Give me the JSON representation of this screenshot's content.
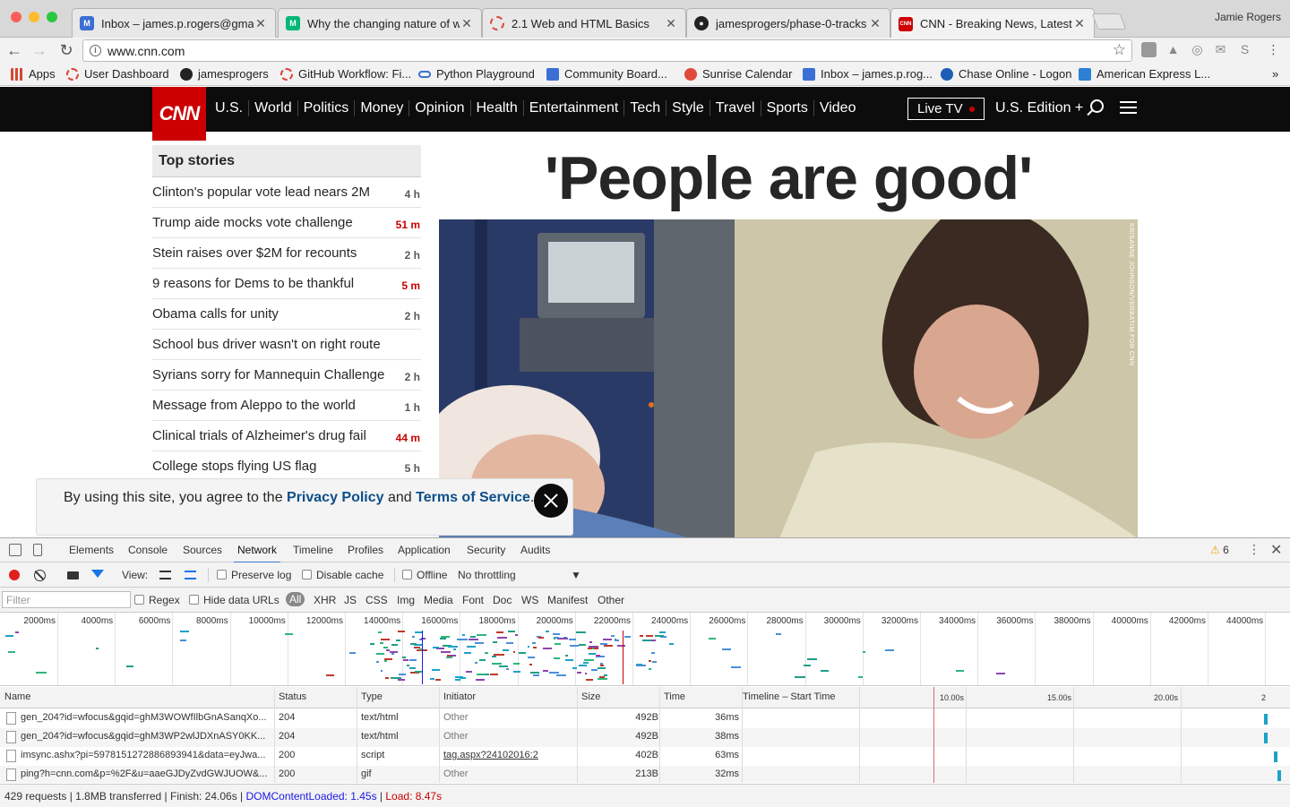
{
  "browser": {
    "tabs": [
      {
        "title": "Inbox – james.p.rogers@gmail.com",
        "icon": "gmail-icon",
        "color": "#3b6fd4"
      },
      {
        "title": "Why the changing nature of work",
        "icon": "medium-icon",
        "color": "#02b875"
      },
      {
        "title": "2.1 Web and HTML Basics",
        "icon": "loading-icon",
        "color": "#d9463a"
      },
      {
        "title": "jamesprogers/phase-0-tracks",
        "icon": "github-icon",
        "color": "#222222"
      },
      {
        "title": "CNN - Breaking News, Latest N",
        "icon": "cnn-icon",
        "color": "#cc0000"
      }
    ],
    "profile_name": "Jamie Rogers",
    "url": "www.cnn.com",
    "bookmarks": [
      {
        "label": "Apps",
        "icon": "apps-icon",
        "color": "#d04a32"
      },
      {
        "label": "User Dashboard",
        "icon": "loading-icon",
        "color": "#d9463a"
      },
      {
        "label": "jamesprogers",
        "icon": "github-icon",
        "color": "#222222"
      },
      {
        "label": "GitHub Workflow: Fi...",
        "icon": "loading-icon",
        "color": "#d9463a"
      },
      {
        "label": "Python Playground",
        "icon": "link-icon",
        "color": "#3b6fd4"
      },
      {
        "label": "Community Board...",
        "icon": "community-icon",
        "color": "#3b6fd4"
      },
      {
        "label": "Sunrise Calendar",
        "icon": "calendar-icon",
        "color": "#e04a3b"
      },
      {
        "label": "Inbox – james.p.rog...",
        "icon": "inbox-icon",
        "color": "#3b6fd4"
      },
      {
        "label": "Chase Online - Logon",
        "icon": "chase-icon",
        "color": "#1a5fb4"
      },
      {
        "label": "American Express L...",
        "icon": "amex-icon",
        "color": "#2e7fd6"
      }
    ],
    "bookmarks_overflow": "»"
  },
  "cnn": {
    "logo": "CNN",
    "nav_links": [
      "U.S.",
      "World",
      "Politics",
      "Money",
      "Opinion",
      "Health",
      "Entertainment",
      "Tech",
      "Style",
      "Travel",
      "Sports",
      "Video"
    ],
    "live_tv": "Live TV",
    "edition": "U.S. Edition +",
    "top_stories_title": "Top stories",
    "stories": [
      {
        "headline": "Clinton's popular vote lead nears 2M",
        "age": "4 h",
        "recent": false
      },
      {
        "headline": "Trump aide mocks vote challenge",
        "age": "51 m",
        "recent": true
      },
      {
        "headline": "Stein raises over $2M for recounts",
        "age": "2 h",
        "recent": false
      },
      {
        "headline": "9 reasons for Dems to be thankful",
        "age": "5 m",
        "recent": true
      },
      {
        "headline": "Obama calls for unity",
        "age": "2 h",
        "recent": false
      },
      {
        "headline": "School bus driver wasn't on right route",
        "age": "",
        "recent": false
      },
      {
        "headline": "Syrians sorry for Mannequin Challenge",
        "age": "2 h",
        "recent": false
      },
      {
        "headline": "Message from Aleppo to the world",
        "age": "1 h",
        "recent": false
      },
      {
        "headline": "Clinical trials of Alzheimer's drug fail",
        "age": "44 m",
        "recent": true
      },
      {
        "headline": "College stops flying US flag",
        "age": "5 h",
        "recent": false
      }
    ],
    "main_headline": "'People are good'",
    "photo_credit": "KRISANNE JOHNSON/VERBATIM FOR CNN",
    "consent": {
      "prefix": "By using this site, you agree to the ",
      "privacy": "Privacy Policy",
      "and": " and ",
      "terms": "Terms of Service",
      "suffix": "."
    }
  },
  "devtools": {
    "tabs": [
      "Elements",
      "Console",
      "Sources",
      "Network",
      "Timeline",
      "Profiles",
      "Application",
      "Security",
      "Audits"
    ],
    "active_tab": "Network",
    "warnings": "6",
    "view_label": "View:",
    "preserve_log": "Preserve log",
    "disable_cache": "Disable cache",
    "offline": "Offline",
    "throttling": "No throttling",
    "filter_placeholder": "Filter",
    "regex": "Regex",
    "hide_data_urls": "Hide data URLs",
    "types": [
      "All",
      "XHR",
      "JS",
      "CSS",
      "Img",
      "Media",
      "Font",
      "Doc",
      "WS",
      "Manifest",
      "Other"
    ],
    "overview_ticks": [
      "2000ms",
      "4000ms",
      "6000ms",
      "8000ms",
      "10000ms",
      "12000ms",
      "14000ms",
      "16000ms",
      "18000ms",
      "20000ms",
      "22000ms",
      "24000ms",
      "26000ms",
      "28000ms",
      "30000ms",
      "32000ms",
      "34000ms",
      "36000ms",
      "38000ms",
      "40000ms",
      "42000ms",
      "44000ms"
    ],
    "columns": [
      "Name",
      "Status",
      "Type",
      "Initiator",
      "Size",
      "Time",
      "Timeline – Start Time"
    ],
    "timeline_labels": [
      "10.00s",
      "15.00s",
      "20.00s",
      "2"
    ],
    "rows": [
      {
        "name": "gen_204?id=wfocus&gqid=ghM3WOWfIlbGnASanqXo...",
        "status": "204",
        "type": "text/html",
        "initiator": "Other",
        "initiator_link": false,
        "size": "492B",
        "time": "36ms"
      },
      {
        "name": "gen_204?id=wfocus&gqid=ghM3WP2wlJDXnASY0KK...",
        "status": "204",
        "type": "text/html",
        "initiator": "Other",
        "initiator_link": false,
        "size": "492B",
        "time": "38ms"
      },
      {
        "name": "imsync.ashx?pi=5978151272886893941&data=eyJwa...",
        "status": "200",
        "type": "script",
        "initiator": "tag.aspx?24102016:2",
        "initiator_link": true,
        "size": "402B",
        "time": "63ms"
      },
      {
        "name": "ping?h=cnn.com&p=%2F&u=aaeGJDyZvdGWJUOW&...",
        "status": "200",
        "type": "gif",
        "initiator": "Other",
        "initiator_link": false,
        "size": "213B",
        "time": "32ms"
      }
    ],
    "status": {
      "summary": "429 requests | 1.8MB transferred | Finish: 24.06s | ",
      "dom_loaded": "DOMContentLoaded: 1.45s",
      "separator": " | ",
      "load": "Load: 8.47s"
    }
  }
}
